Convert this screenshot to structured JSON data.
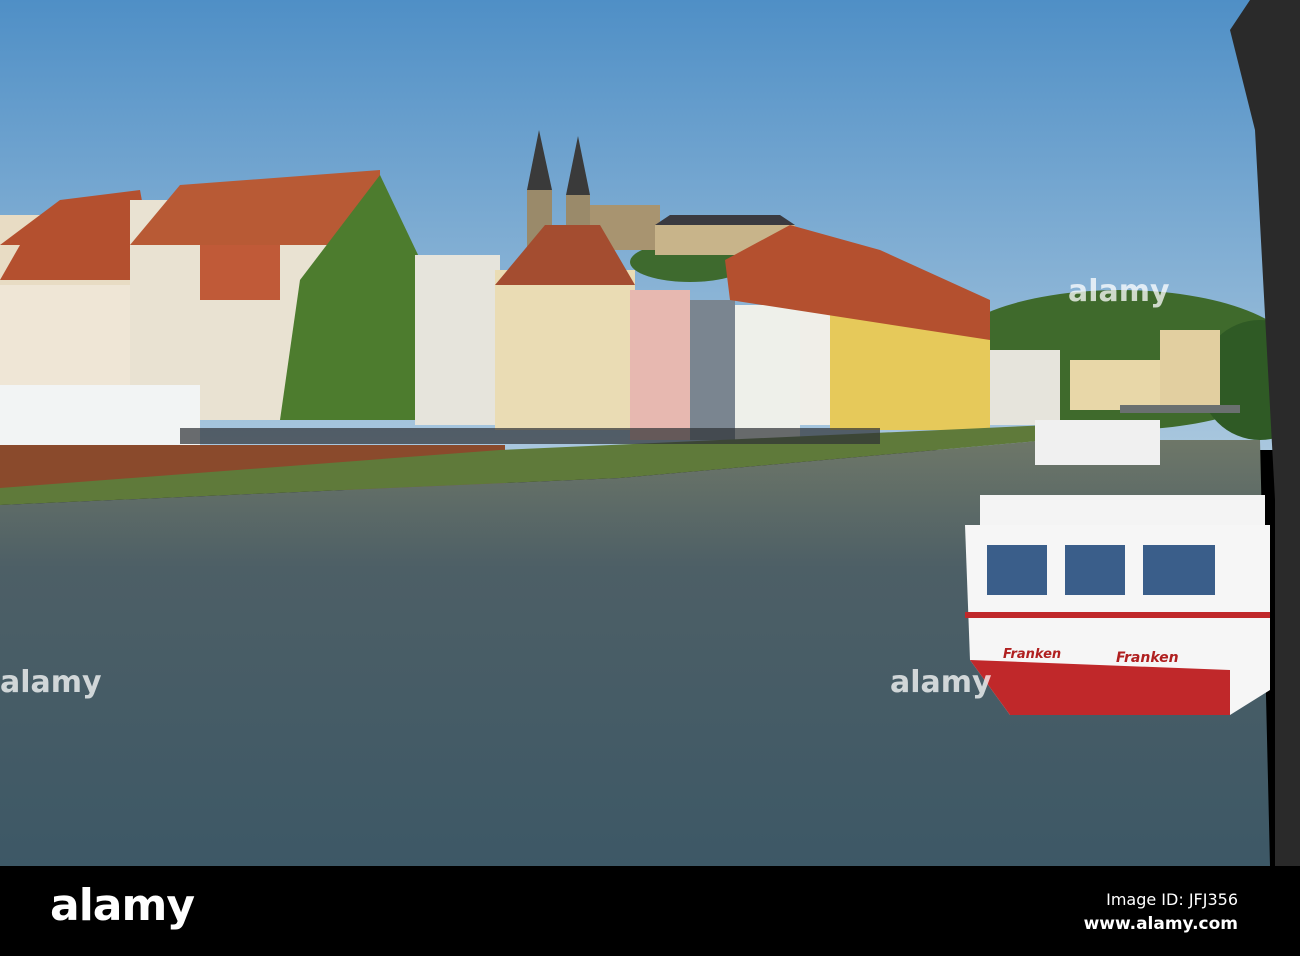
{
  "photo": {
    "boat_name_left": "Franken",
    "boat_name_right": "Franken"
  },
  "watermark": {
    "text": "alamy",
    "mark": "a"
  },
  "footer": {
    "logo": "alamy",
    "image_id": "Image ID: JFJ356",
    "url": "www.alamy.com"
  },
  "colors": {
    "sky_top": "#4f8fc6",
    "sky_bottom": "#a9c7de",
    "water": "#4a5c66",
    "roof": "#b4502f",
    "boat_red": "#c0282a"
  }
}
